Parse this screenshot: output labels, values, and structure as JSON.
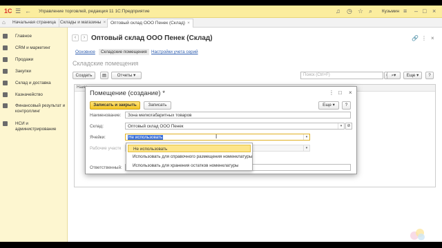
{
  "app": {
    "logo": "1С",
    "title": "Управление торговлей, редакция 11 1С:Предприятие",
    "user": "Кузьмин"
  },
  "tabs": [
    {
      "label": "Начальная страница"
    },
    {
      "label": "Склады и магазины"
    },
    {
      "label": "Оптовый склад ООО Пенек (Склад)"
    }
  ],
  "sidebar": {
    "items": [
      {
        "label": "Главное"
      },
      {
        "label": "CRM и маркетинг"
      },
      {
        "label": "Продажи"
      },
      {
        "label": "Закупки"
      },
      {
        "label": "Склад и доставка"
      },
      {
        "label": "Казначейство"
      },
      {
        "label": "Финансовый результат и контроллинг"
      },
      {
        "label": "НСИ и администрирование"
      }
    ]
  },
  "page": {
    "title": "Оптовый склад ООО Пенек (Склад)",
    "subtabs": [
      "Основное",
      "Складские помещения",
      "Настройки учета серий"
    ],
    "section_title": "Складские помещения",
    "create_label": "Создать",
    "reports_label": "Отчеты",
    "search_placeholder": "Поиск (Ctrl+F)",
    "more_label": "Еще",
    "column_name": "Наим"
  },
  "modal": {
    "title": "Помещение (создание) *",
    "save_close_label": "Записать и закрыть",
    "save_label": "Записать",
    "more_label": "Еще",
    "help_label": "?",
    "fields": {
      "name_label": "Наименование:",
      "name_value": "Зона мелкогабаритных товаров",
      "warehouse_label": "Склад:",
      "warehouse_value": "Оптовый склад ООО Пенек",
      "cells_label": "Ячейки:",
      "cells_value": "Не использовать",
      "work_areas_label": "Рабочие участк",
      "responsible_label": "Ответственный:"
    }
  },
  "dropdown": {
    "options": [
      "Не использовать",
      "Использовать для справочного размещения номенклатуры",
      "Использовать для хранения остатков номенклатуры"
    ]
  },
  "colors": {
    "title_bar": "#fbed9e",
    "sidebar": "#fdf6d0",
    "primary_button": "#f5c623",
    "highlight": "#fde58a",
    "link": "#2b5bae"
  }
}
